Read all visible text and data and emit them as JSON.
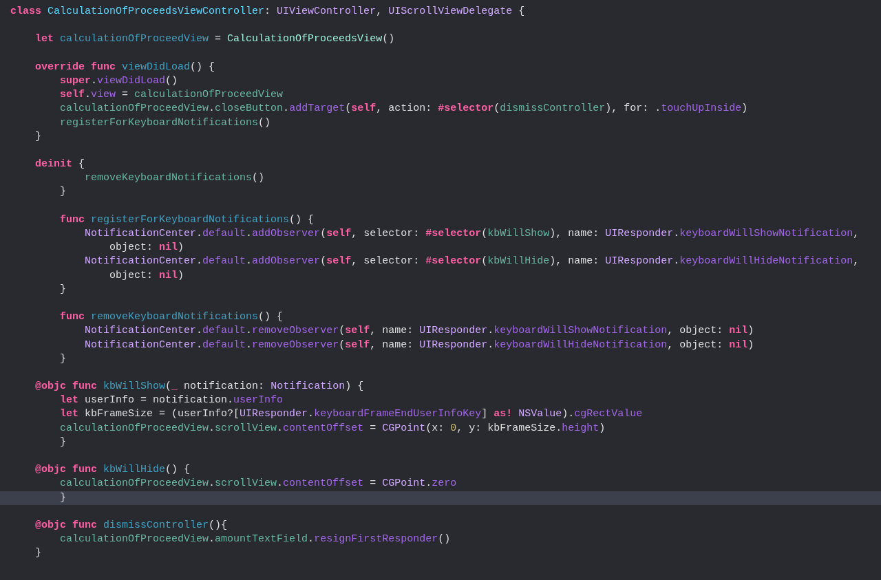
{
  "editor": {
    "lines": [
      {
        "current": false,
        "tokens": [
          {
            "text": "class ",
            "kind": "kw"
          },
          {
            "text": "CalculationOfProceedsViewController",
            "kind": "decltype"
          },
          {
            "text": ": ",
            "kind": "plain"
          },
          {
            "text": "UIViewController",
            "kind": "systype"
          },
          {
            "text": ", ",
            "kind": "plain"
          },
          {
            "text": "UIScrollViewDelegate",
            "kind": "systype"
          },
          {
            "text": " {",
            "kind": "plain"
          }
        ]
      },
      {
        "current": false
      },
      {
        "current": false,
        "tokens": [
          {
            "text": "    let ",
            "kind": "kw"
          },
          {
            "text": "calculationOfProceedView",
            "kind": "decl"
          },
          {
            "text": " = ",
            "kind": "plain"
          },
          {
            "text": "CalculationOfProceedsView",
            "kind": "projtype"
          },
          {
            "text": "()",
            "kind": "plain"
          }
        ]
      },
      {
        "current": false
      },
      {
        "current": false,
        "tokens": [
          {
            "text": "    override func ",
            "kind": "kw"
          },
          {
            "text": "viewDidLoad",
            "kind": "decl"
          },
          {
            "text": "() {",
            "kind": "plain"
          }
        ]
      },
      {
        "current": false,
        "tokens": [
          {
            "text": "        super",
            "kind": "kw"
          },
          {
            "text": ".",
            "kind": "plain"
          },
          {
            "text": "viewDidLoad",
            "kind": "sys"
          },
          {
            "text": "()",
            "kind": "plain"
          }
        ]
      },
      {
        "current": false,
        "tokens": [
          {
            "text": "        self",
            "kind": "kw"
          },
          {
            "text": ".",
            "kind": "plain"
          },
          {
            "text": "view",
            "kind": "sys"
          },
          {
            "text": " = ",
            "kind": "plain"
          },
          {
            "text": "calculationOfProceedView",
            "kind": "proj"
          }
        ]
      },
      {
        "current": false,
        "tokens": [
          {
            "text": "        calculationOfProceedView",
            "kind": "proj"
          },
          {
            "text": ".",
            "kind": "plain"
          },
          {
            "text": "closeButton",
            "kind": "proj"
          },
          {
            "text": ".",
            "kind": "plain"
          },
          {
            "text": "addTarget",
            "kind": "sys"
          },
          {
            "text": "(",
            "kind": "plain"
          },
          {
            "text": "self",
            "kind": "kw"
          },
          {
            "text": ", action: ",
            "kind": "plain"
          },
          {
            "text": "#selector",
            "kind": "kw"
          },
          {
            "text": "(",
            "kind": "plain"
          },
          {
            "text": "dismissController",
            "kind": "proj"
          },
          {
            "text": "), for: .",
            "kind": "plain"
          },
          {
            "text": "touchUpInside",
            "kind": "sys"
          },
          {
            "text": ")",
            "kind": "plain"
          }
        ]
      },
      {
        "current": false,
        "tokens": [
          {
            "text": "        registerForKeyboardNotifications",
            "kind": "proj"
          },
          {
            "text": "()",
            "kind": "plain"
          }
        ]
      },
      {
        "current": false,
        "tokens": [
          {
            "text": "    }",
            "kind": "plain"
          }
        ]
      },
      {
        "current": false
      },
      {
        "current": false,
        "tokens": [
          {
            "text": "    deinit",
            "kind": "kw"
          },
          {
            "text": " {",
            "kind": "plain"
          }
        ]
      },
      {
        "current": false,
        "tokens": [
          {
            "text": "            removeKeyboardNotifications",
            "kind": "proj"
          },
          {
            "text": "()",
            "kind": "plain"
          }
        ]
      },
      {
        "current": false,
        "tokens": [
          {
            "text": "        }",
            "kind": "plain"
          }
        ]
      },
      {
        "current": false
      },
      {
        "current": false,
        "tokens": [
          {
            "text": "        func ",
            "kind": "kw"
          },
          {
            "text": "registerForKeyboardNotifications",
            "kind": "decl"
          },
          {
            "text": "() {",
            "kind": "plain"
          }
        ]
      },
      {
        "current": false,
        "tokens": [
          {
            "text": "            NotificationCenter",
            "kind": "systype"
          },
          {
            "text": ".",
            "kind": "plain"
          },
          {
            "text": "default",
            "kind": "sys"
          },
          {
            "text": ".",
            "kind": "plain"
          },
          {
            "text": "addObserver",
            "kind": "sys"
          },
          {
            "text": "(",
            "kind": "plain"
          },
          {
            "text": "self",
            "kind": "kw"
          },
          {
            "text": ", selector: ",
            "kind": "plain"
          },
          {
            "text": "#selector",
            "kind": "kw"
          },
          {
            "text": "(",
            "kind": "plain"
          },
          {
            "text": "kbWillShow",
            "kind": "proj"
          },
          {
            "text": "), name: ",
            "kind": "plain"
          },
          {
            "text": "UIResponder",
            "kind": "systype"
          },
          {
            "text": ".",
            "kind": "plain"
          },
          {
            "text": "keyboardWillShowNotification",
            "kind": "sys"
          },
          {
            "text": ",",
            "kind": "plain"
          }
        ]
      },
      {
        "current": false,
        "tokens": [
          {
            "text": "                object: ",
            "kind": "plain"
          },
          {
            "text": "nil",
            "kind": "kw"
          },
          {
            "text": ")",
            "kind": "plain"
          }
        ]
      },
      {
        "current": false,
        "tokens": [
          {
            "text": "            NotificationCenter",
            "kind": "systype"
          },
          {
            "text": ".",
            "kind": "plain"
          },
          {
            "text": "default",
            "kind": "sys"
          },
          {
            "text": ".",
            "kind": "plain"
          },
          {
            "text": "addObserver",
            "kind": "sys"
          },
          {
            "text": "(",
            "kind": "plain"
          },
          {
            "text": "self",
            "kind": "kw"
          },
          {
            "text": ", selector: ",
            "kind": "plain"
          },
          {
            "text": "#selector",
            "kind": "kw"
          },
          {
            "text": "(",
            "kind": "plain"
          },
          {
            "text": "kbWillHide",
            "kind": "proj"
          },
          {
            "text": "), name: ",
            "kind": "plain"
          },
          {
            "text": "UIResponder",
            "kind": "systype"
          },
          {
            "text": ".",
            "kind": "plain"
          },
          {
            "text": "keyboardWillHideNotification",
            "kind": "sys"
          },
          {
            "text": ",",
            "kind": "plain"
          }
        ]
      },
      {
        "current": false,
        "tokens": [
          {
            "text": "                object: ",
            "kind": "plain"
          },
          {
            "text": "nil",
            "kind": "kw"
          },
          {
            "text": ")",
            "kind": "plain"
          }
        ]
      },
      {
        "current": false,
        "tokens": [
          {
            "text": "        }",
            "kind": "plain"
          }
        ]
      },
      {
        "current": false
      },
      {
        "current": false,
        "tokens": [
          {
            "text": "        func ",
            "kind": "kw"
          },
          {
            "text": "removeKeyboardNotifications",
            "kind": "decl"
          },
          {
            "text": "() {",
            "kind": "plain"
          }
        ]
      },
      {
        "current": false,
        "tokens": [
          {
            "text": "            NotificationCenter",
            "kind": "systype"
          },
          {
            "text": ".",
            "kind": "plain"
          },
          {
            "text": "default",
            "kind": "sys"
          },
          {
            "text": ".",
            "kind": "plain"
          },
          {
            "text": "removeObserver",
            "kind": "sys"
          },
          {
            "text": "(",
            "kind": "plain"
          },
          {
            "text": "self",
            "kind": "kw"
          },
          {
            "text": ", name: ",
            "kind": "plain"
          },
          {
            "text": "UIResponder",
            "kind": "systype"
          },
          {
            "text": ".",
            "kind": "plain"
          },
          {
            "text": "keyboardWillShowNotification",
            "kind": "sys"
          },
          {
            "text": ", object: ",
            "kind": "plain"
          },
          {
            "text": "nil",
            "kind": "kw"
          },
          {
            "text": ")",
            "kind": "plain"
          }
        ]
      },
      {
        "current": false,
        "tokens": [
          {
            "text": "            NotificationCenter",
            "kind": "systype"
          },
          {
            "text": ".",
            "kind": "plain"
          },
          {
            "text": "default",
            "kind": "sys"
          },
          {
            "text": ".",
            "kind": "plain"
          },
          {
            "text": "removeObserver",
            "kind": "sys"
          },
          {
            "text": "(",
            "kind": "plain"
          },
          {
            "text": "self",
            "kind": "kw"
          },
          {
            "text": ", name: ",
            "kind": "plain"
          },
          {
            "text": "UIResponder",
            "kind": "systype"
          },
          {
            "text": ".",
            "kind": "plain"
          },
          {
            "text": "keyboardWillHideNotification",
            "kind": "sys"
          },
          {
            "text": ", object: ",
            "kind": "plain"
          },
          {
            "text": "nil",
            "kind": "kw"
          },
          {
            "text": ")",
            "kind": "plain"
          }
        ]
      },
      {
        "current": false,
        "tokens": [
          {
            "text": "        }",
            "kind": "plain"
          }
        ]
      },
      {
        "current": false
      },
      {
        "current": false,
        "tokens": [
          {
            "text": "    @objc func ",
            "kind": "kw"
          },
          {
            "text": "kbWillShow",
            "kind": "decl"
          },
          {
            "text": "(",
            "kind": "plain"
          },
          {
            "text": "_",
            "kind": "kw"
          },
          {
            "text": " notification: ",
            "kind": "plain"
          },
          {
            "text": "Notification",
            "kind": "systype"
          },
          {
            "text": ") {",
            "kind": "plain"
          }
        ]
      },
      {
        "current": false,
        "tokens": [
          {
            "text": "        let",
            "kind": "kw"
          },
          {
            "text": " userInfo = notification.",
            "kind": "plain"
          },
          {
            "text": "userInfo",
            "kind": "sys"
          }
        ]
      },
      {
        "current": false,
        "tokens": [
          {
            "text": "        let",
            "kind": "kw"
          },
          {
            "text": " kbFrameSize = (userInfo?[",
            "kind": "plain"
          },
          {
            "text": "UIResponder",
            "kind": "systype"
          },
          {
            "text": ".",
            "kind": "plain"
          },
          {
            "text": "keyboardFrameEndUserInfoKey",
            "kind": "sys"
          },
          {
            "text": "] ",
            "kind": "plain"
          },
          {
            "text": "as! ",
            "kind": "kw"
          },
          {
            "text": "NSValue",
            "kind": "systype"
          },
          {
            "text": ").",
            "kind": "plain"
          },
          {
            "text": "cgRectValue",
            "kind": "sys"
          }
        ]
      },
      {
        "current": false,
        "tokens": [
          {
            "text": "        calculationOfProceedView",
            "kind": "proj"
          },
          {
            "text": ".",
            "kind": "plain"
          },
          {
            "text": "scrollView",
            "kind": "proj"
          },
          {
            "text": ".",
            "kind": "plain"
          },
          {
            "text": "contentOffset",
            "kind": "sys"
          },
          {
            "text": " = ",
            "kind": "plain"
          },
          {
            "text": "CGPoint",
            "kind": "systype"
          },
          {
            "text": "(x: ",
            "kind": "plain"
          },
          {
            "text": "0",
            "kind": "num"
          },
          {
            "text": ", y: kbFrameSize.",
            "kind": "plain"
          },
          {
            "text": "height",
            "kind": "sys"
          },
          {
            "text": ")",
            "kind": "plain"
          }
        ]
      },
      {
        "current": false,
        "tokens": [
          {
            "text": "        }",
            "kind": "plain"
          }
        ]
      },
      {
        "current": false
      },
      {
        "current": false,
        "tokens": [
          {
            "text": "    @objc func ",
            "kind": "kw"
          },
          {
            "text": "kbWillHide",
            "kind": "decl"
          },
          {
            "text": "() {",
            "kind": "plain"
          }
        ]
      },
      {
        "current": false,
        "tokens": [
          {
            "text": "        calculationOfProceedView",
            "kind": "proj"
          },
          {
            "text": ".",
            "kind": "plain"
          },
          {
            "text": "scrollView",
            "kind": "proj"
          },
          {
            "text": ".",
            "kind": "plain"
          },
          {
            "text": "contentOffset",
            "kind": "sys"
          },
          {
            "text": " = ",
            "kind": "plain"
          },
          {
            "text": "CGPoint",
            "kind": "systype"
          },
          {
            "text": ".",
            "kind": "plain"
          },
          {
            "text": "zero",
            "kind": "sys"
          }
        ]
      },
      {
        "current": true,
        "tokens": [
          {
            "text": "        }",
            "kind": "plain"
          }
        ]
      },
      {
        "current": false
      },
      {
        "current": false,
        "tokens": [
          {
            "text": "    @objc func ",
            "kind": "kw"
          },
          {
            "text": "dismissController",
            "kind": "decl"
          },
          {
            "text": "(){",
            "kind": "plain"
          }
        ]
      },
      {
        "current": false,
        "tokens": [
          {
            "text": "        calculationOfProceedView",
            "kind": "proj"
          },
          {
            "text": ".",
            "kind": "plain"
          },
          {
            "text": "amountTextField",
            "kind": "proj"
          },
          {
            "text": ".",
            "kind": "plain"
          },
          {
            "text": "resignFirstResponder",
            "kind": "sys"
          },
          {
            "text": "()",
            "kind": "plain"
          }
        ]
      },
      {
        "current": false,
        "tokens": [
          {
            "text": "    }",
            "kind": "plain"
          }
        ]
      }
    ]
  }
}
